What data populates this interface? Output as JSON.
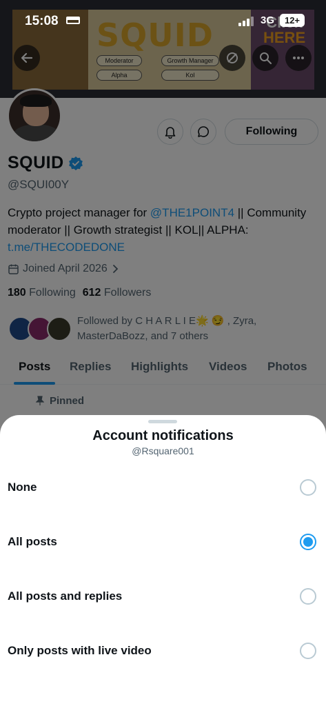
{
  "status_bar": {
    "time": "15:08",
    "network": "3G",
    "battery": "12+"
  },
  "banner": {
    "title": "SQUID",
    "roles": [
      "Moderator",
      "Growth Manager",
      "Alpha",
      "Kol"
    ],
    "cta_line1": "Click",
    "cta_line2": "HERE"
  },
  "profile": {
    "name": "SQUID",
    "handle": "@SQUI00Y",
    "bio_part1": "Crypto project manager for ",
    "bio_mention": "@THE1POINT4",
    "bio_part2": " || Community moderator || Growth strategist || KOL|| ALPHA: ",
    "bio_link": "t.me/THECODEDONE",
    "joined": "Joined April 2026",
    "following_count": "180",
    "following_label": "Following",
    "followers_count": "612",
    "followers_label": "Followers",
    "followed_by": "Followed by C H A R L I E🌟 😏 , Zyra, MasterDaBozz, and 7 others",
    "follow_button": "Following"
  },
  "tabs": [
    "Posts",
    "Replies",
    "Highlights",
    "Videos",
    "Photos"
  ],
  "active_tab": "Posts",
  "pinned_label": "Pinned",
  "sheet": {
    "title": "Account notifications",
    "subtitle": "@Rsquare001",
    "options": [
      {
        "label": "None",
        "selected": false
      },
      {
        "label": "All posts",
        "selected": true
      },
      {
        "label": "All posts and replies",
        "selected": false
      },
      {
        "label": "Only posts with live video",
        "selected": false
      }
    ]
  },
  "colors": {
    "accent": "#1d9bf0",
    "text": "#0f1419",
    "secondary": "#536471"
  }
}
